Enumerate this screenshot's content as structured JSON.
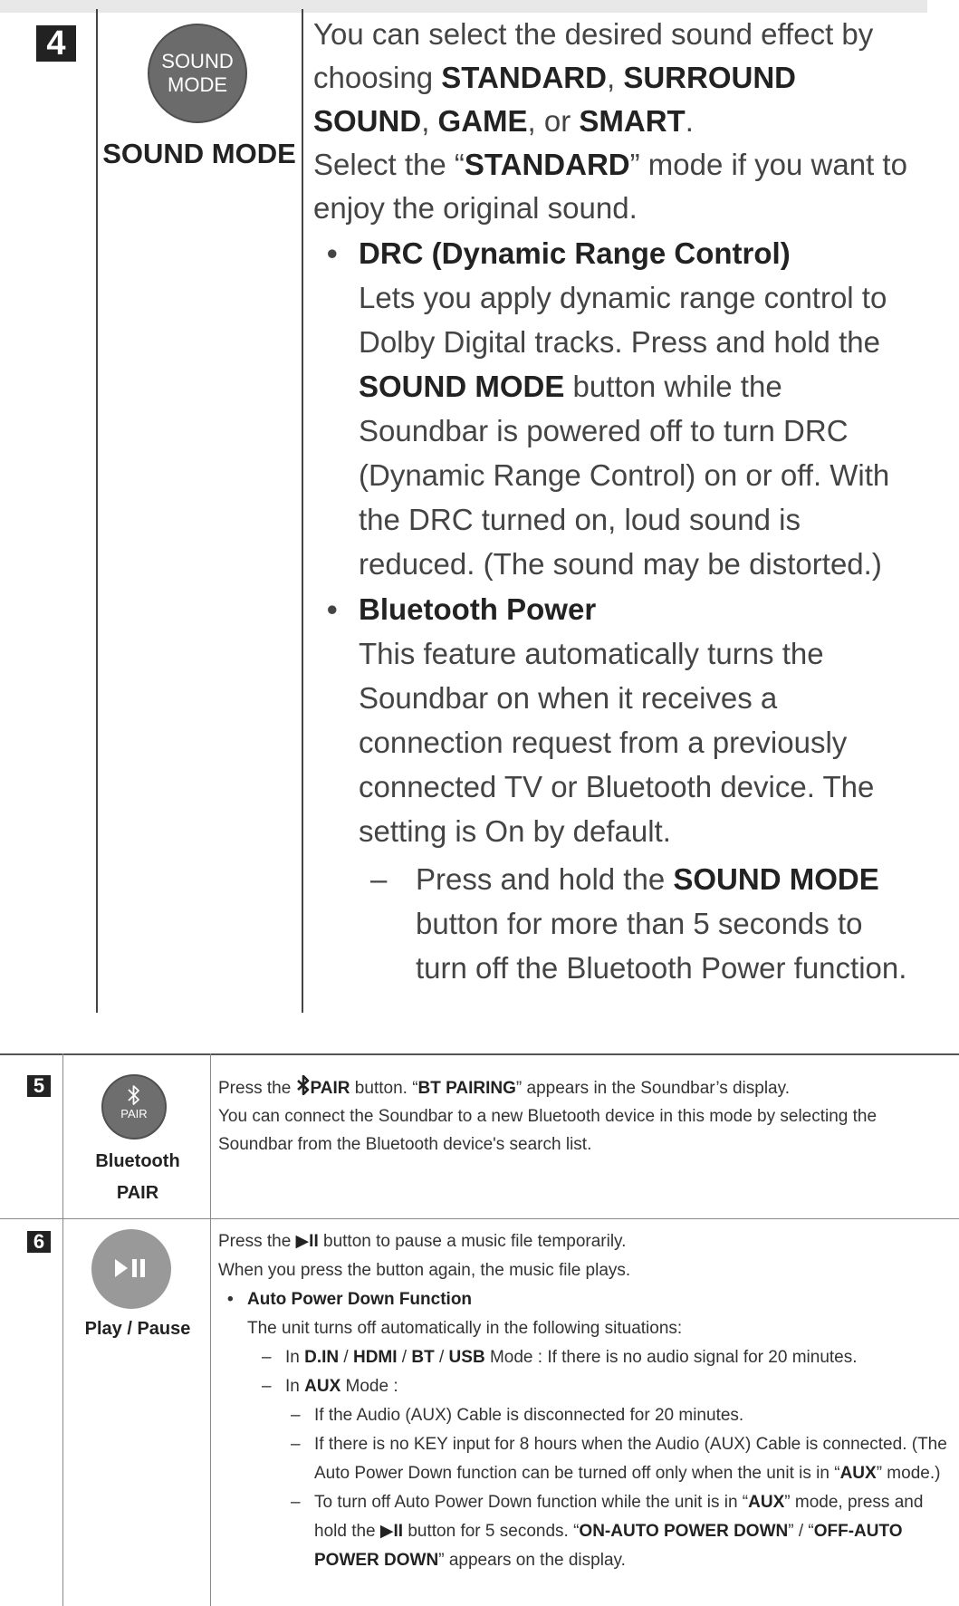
{
  "section4": {
    "number": "4",
    "button": {
      "line1": "SOUND",
      "line2": "MODE"
    },
    "label": "SOUND MODE",
    "para1": {
      "pre": "You can select the desired sound effect by choosing ",
      "m1": "STANDARD",
      "s1": ", ",
      "m2": "SURROUND SOUND",
      "s2": ", ",
      "m3": "GAME",
      "s3": ", or ",
      "m4": "SMART",
      "s4": "."
    },
    "para2": {
      "pre": "Select the “",
      "mode": "STANDARD",
      "post": "” mode if you want to enjoy the original sound."
    },
    "drc": {
      "title": "DRC (Dynamic Range Control)",
      "pre": "Lets you apply dynamic range control to Dolby Digital tracks. Press and hold the ",
      "btn": "SOUND MODE",
      "post": " button while the Soundbar is powered off to turn DRC (Dynamic Range Control) on or off. With the DRC turned on, loud sound is reduced. (The sound may be distorted.)"
    },
    "btpower": {
      "title": "Bluetooth Power",
      "body": "This feature automatically turns the Soundbar on when it receives a connection request from a previously connected TV or Bluetooth device. The setting is On by default.",
      "dash_pre": "Press and hold the ",
      "dash_btn": "SOUND MODE",
      "dash_post": " button for more than 5 seconds to turn off the Bluetooth Power function."
    }
  },
  "section5": {
    "number": "5",
    "button_text": "PAIR",
    "label1": "Bluetooth",
    "label2": "PAIR",
    "l1_pre": "Press the ",
    "l1_btn": "PAIR",
    "l1_mid": " button. “",
    "l1_disp": "BT PAIRING",
    "l1_post": "” appears in the Soundbar’s display.",
    "l2": "You can connect the Soundbar to a new Bluetooth device in this mode by selecting the Soundbar from the Bluetooth device's search list."
  },
  "section6": {
    "number": "6",
    "label": "Play / Pause",
    "l1_pre": "Press the ",
    "l1_btn": "▶II",
    "l1_post": " button to pause a music file temporarily.",
    "l2": "When you press the button again, the music file plays.",
    "apd_title": "Auto Power Down Function",
    "apd_intro": "The unit turns off automatically in the following situations:",
    "d1_pre": "In ",
    "d1_m1": "D.IN",
    "d1_s1": " / ",
    "d1_m2": "HDMI",
    "d1_s2": " / ",
    "d1_m3": "BT",
    "d1_s3": " / ",
    "d1_m4": "USB",
    "d1_post": " Mode : If there is no audio signal for 20 minutes.",
    "d2_pre": "In ",
    "d2_mode": "AUX",
    "d2_post": " Mode :",
    "s1": "If the Audio (AUX) Cable is disconnected for 20 minutes.",
    "s2_a": "If there is no KEY input for 8 hours when the Audio (AUX) Cable is connected. (The Auto Power Down function can be turned off only when the unit is in “",
    "s2_mode": "AUX",
    "s2_b": "” mode.)",
    "s3_a": "To turn off Auto Power Down function while the unit is in “",
    "s3_mode": "AUX",
    "s3_b": "” mode, press and hold the ",
    "s3_btn": "▶II",
    "s3_c": " button for 5 seconds. “",
    "s3_on": "ON-AUTO POWER DOWN",
    "s3_d": "” / “",
    "s3_off": "OFF-AUTO POWER DOWN",
    "s3_e": "” appears on the display."
  }
}
